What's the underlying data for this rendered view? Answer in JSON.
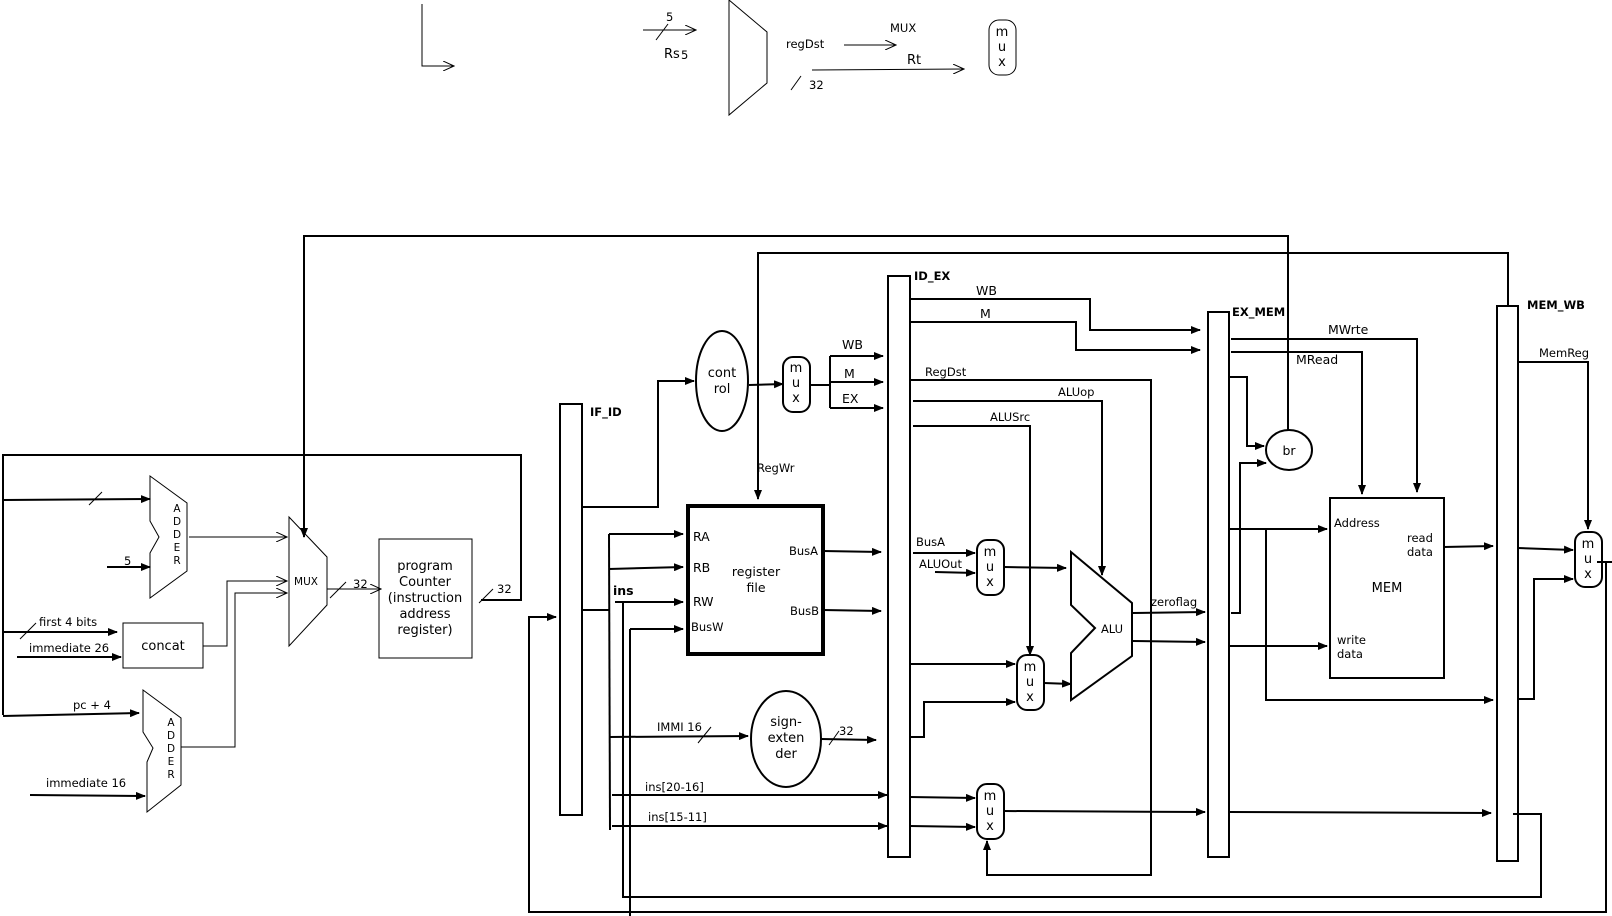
{
  "legend_top": {
    "width_5": "5",
    "rs": "Rs",
    "rs_width": "5",
    "regdst": "regDst",
    "mux_word": "MUX",
    "rt": "Rt",
    "width_32": "32",
    "mux_m": "m",
    "mux_u": "u",
    "mux_x": "x"
  },
  "fetch": {
    "adder_letters": [
      "A",
      "D",
      "D",
      "E",
      "R"
    ],
    "adder_input_5": "5",
    "first_4_bits": "first 4 bits",
    "immediate_26": "immediate 26",
    "concat": "concat",
    "pc_plus_4": "pc + 4",
    "immediate_16": "immediate 16",
    "pc_mux": "MUX",
    "width_32_a": "32",
    "width_32_b": "32",
    "program_counter": [
      "program",
      "Counter",
      "(instruction",
      "address",
      "register)"
    ]
  },
  "decode": {
    "if_id": "IF_ID",
    "ins": "ins",
    "control": [
      "cont",
      "rol"
    ],
    "regwr": "RegWr",
    "register_file": [
      "register",
      "file"
    ],
    "ports_in": [
      "RA",
      "RB",
      "RW",
      "BusW"
    ],
    "bus_a": "BusA",
    "bus_b": "BusB",
    "immi_16": "IMMI  16",
    "sign_extender": [
      "sign-",
      "exten",
      "der"
    ],
    "width_32": "32",
    "ins_20_16": "ins[20-16]",
    "ins_15_11": "ins[15-11]",
    "ctrl_wb": "WB",
    "ctrl_m": "M",
    "ctrl_ex": "EX"
  },
  "execute": {
    "id_ex": "ID_EX",
    "wb": "WB",
    "m": "M",
    "regdst": "RegDst",
    "aluop": "ALUop",
    "alusrc": "ALUSrc",
    "busa": "BusA",
    "aluout": "ALUOut",
    "alu": "ALU",
    "zeroflag": "zeroflag"
  },
  "memory": {
    "ex_mem": "EX_MEM",
    "mwrte": "MWrte",
    "mread": "MRead",
    "br": "br",
    "mem": "MEM",
    "address": "Address",
    "read_data": [
      "read",
      "data"
    ],
    "write_data": [
      "write",
      "data"
    ]
  },
  "writeback": {
    "mem_wb": "MEM_WB",
    "memreg": "MemReg"
  }
}
